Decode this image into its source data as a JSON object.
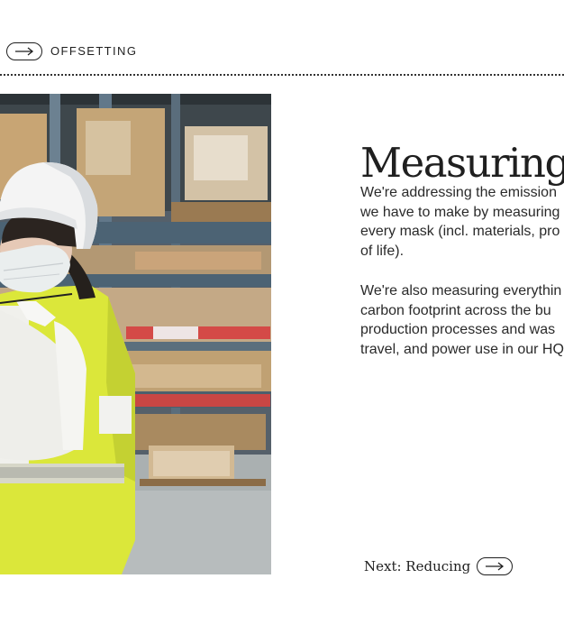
{
  "section": {
    "label": "OFFSETTING",
    "arrow_icon": "arrow-right-icon"
  },
  "hero_image": {
    "subject": "worker-in-warehouse",
    "colors": {
      "vest": "#d6ea3b",
      "helmet": "#f2f2f2",
      "shelving": "#3d4a52",
      "boxes": "#c9a77a"
    }
  },
  "content": {
    "headline": "Measuring",
    "paragraph1_lines": [
      "We're addressing the emission",
      "we have to make by measuring",
      "every mask (incl. materials, pro",
      "of life)."
    ],
    "paragraph2_lines": [
      "We're also measuring everythin",
      "carbon footprint across the bu",
      "production processes and was",
      "travel, and power use in our HQ"
    ]
  },
  "next": {
    "label": "Next: Reducing",
    "arrow_icon": "arrow-right-icon"
  }
}
